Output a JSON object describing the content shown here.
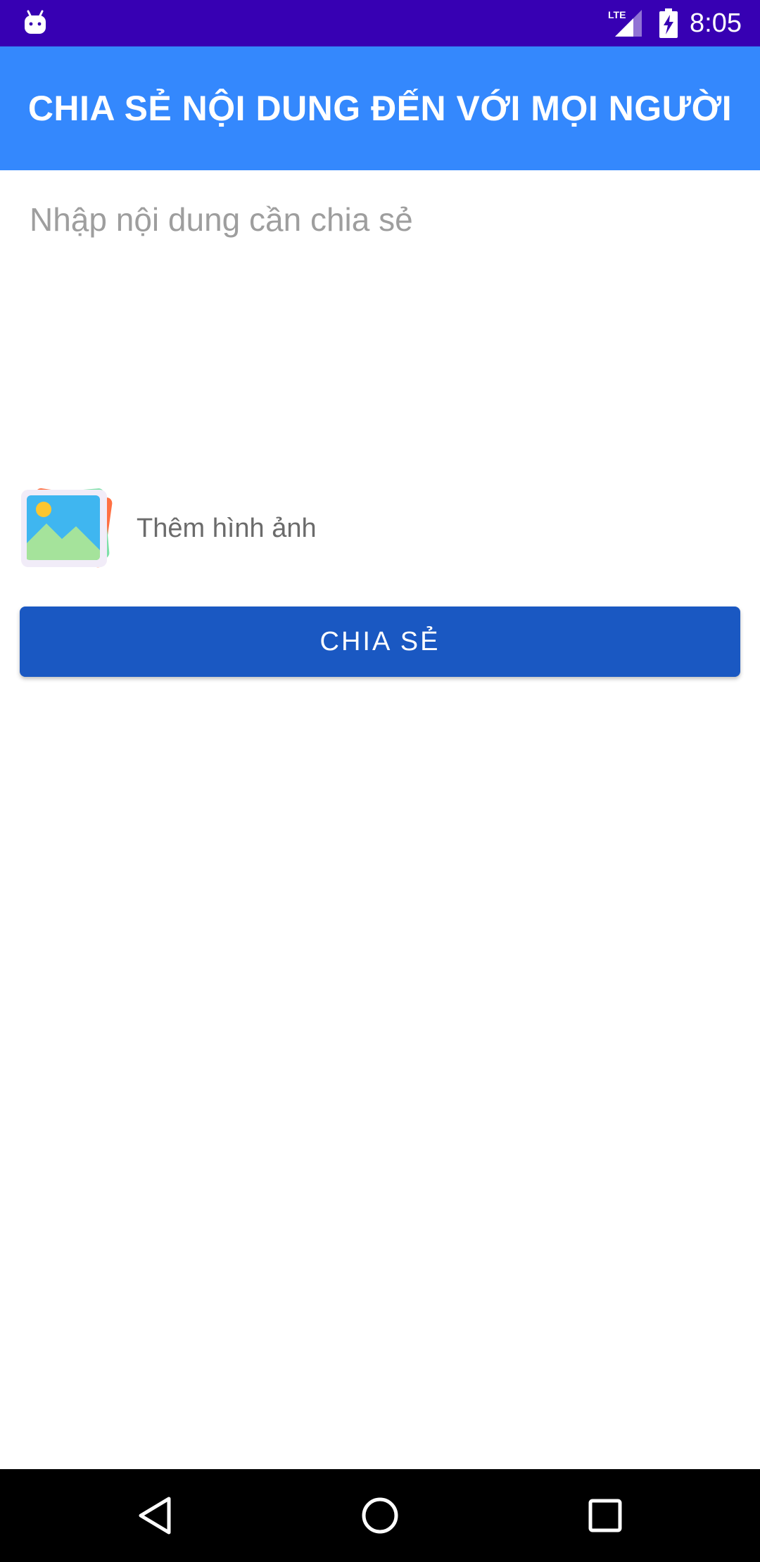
{
  "status_bar": {
    "time": "8:05",
    "network": "LTE",
    "icons": [
      "android-debug-icon",
      "lte-signal-icon",
      "battery-charging-icon"
    ]
  },
  "app_bar": {
    "title": "CHIA SẺ NỘI DUNG ĐẾN VỚI MỌI NGƯỜI"
  },
  "content": {
    "input_value": "",
    "input_placeholder": "Nhập nội dung cần chia sẻ"
  },
  "add_image": {
    "label": "Thêm hình ảnh",
    "icon": "gallery-icon"
  },
  "share_button": {
    "label": "CHIA SẺ"
  },
  "nav_bar": {
    "icons": [
      "back-icon",
      "home-icon",
      "recents-icon"
    ]
  },
  "colors": {
    "status_bar": "#3700b3",
    "app_bar": "#3488fd",
    "share_button": "#1a58c2",
    "placeholder_text": "#9e9e9e",
    "secondary_text": "#6b6b6b",
    "nav_bar": "#000000"
  }
}
